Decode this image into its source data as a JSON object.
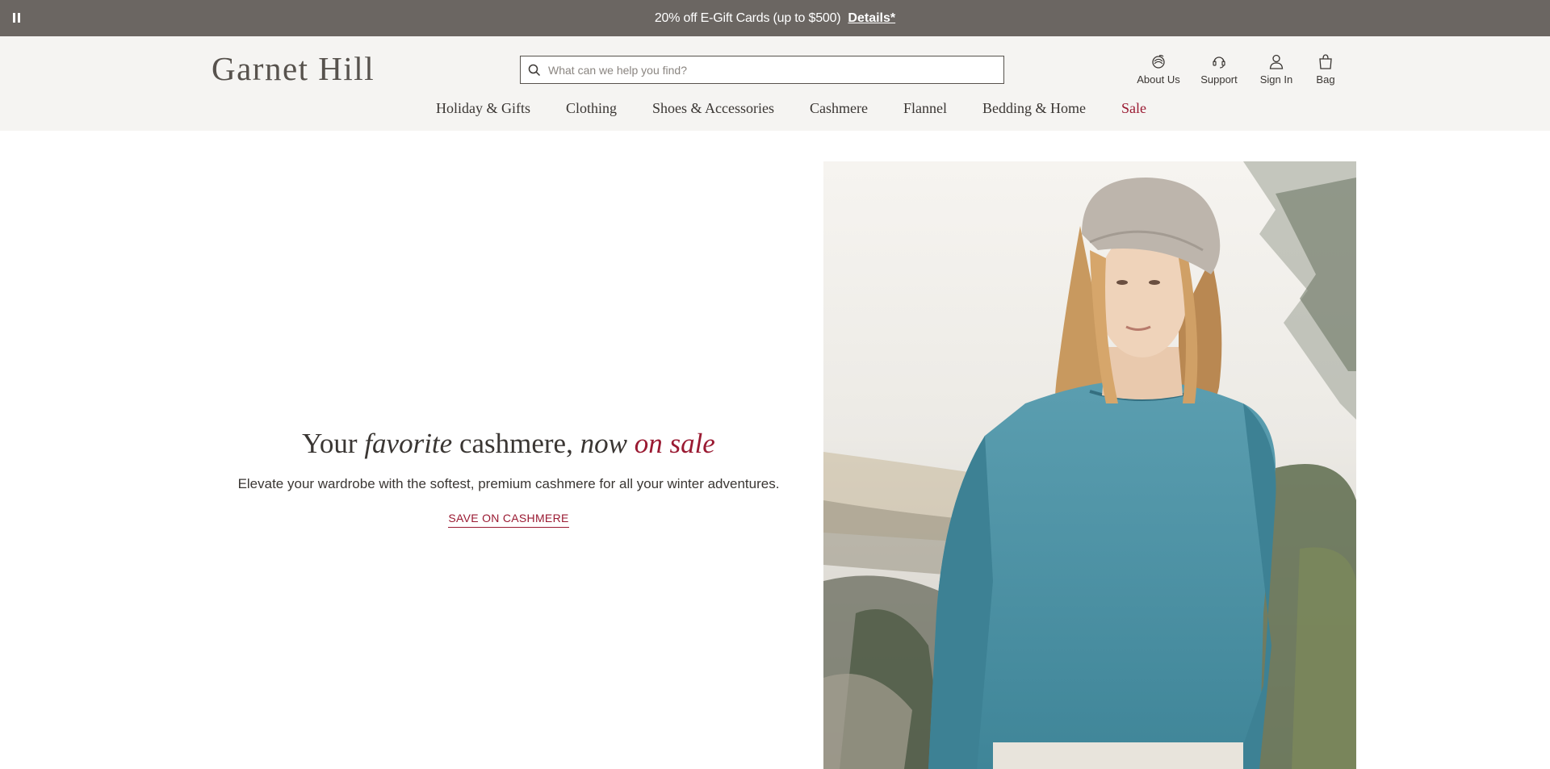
{
  "promo": {
    "text": "20% off E-Gift Cards (up to $500)",
    "details": "Details*"
  },
  "header": {
    "logo": "Garnet Hill",
    "search_placeholder": "What can we help you find?",
    "utility": {
      "about": "About Us",
      "support": "Support",
      "signin": "Sign In",
      "bag": "Bag"
    }
  },
  "nav": {
    "items": [
      {
        "label": "Holiday & Gifts"
      },
      {
        "label": "Clothing"
      },
      {
        "label": "Shoes & Accessories"
      },
      {
        "label": "Cashmere"
      },
      {
        "label": "Flannel"
      },
      {
        "label": "Bedding & Home"
      },
      {
        "label": "Sale"
      }
    ]
  },
  "hero": {
    "heading": {
      "p1": "Your ",
      "p2": "favorite",
      "p3": " cashmere, ",
      "p4": "now ",
      "p5": "on sale"
    },
    "subtitle": "Elevate your wardrobe with the softest, premium cashmere for all your winter adventures.",
    "cta": "SAVE ON CASHMERE"
  },
  "colors": {
    "promo_bg": "#6b6662",
    "header_bg": "#f5f4f2",
    "accent_red": "#9a1a32",
    "text_dark": "#3a3633"
  }
}
